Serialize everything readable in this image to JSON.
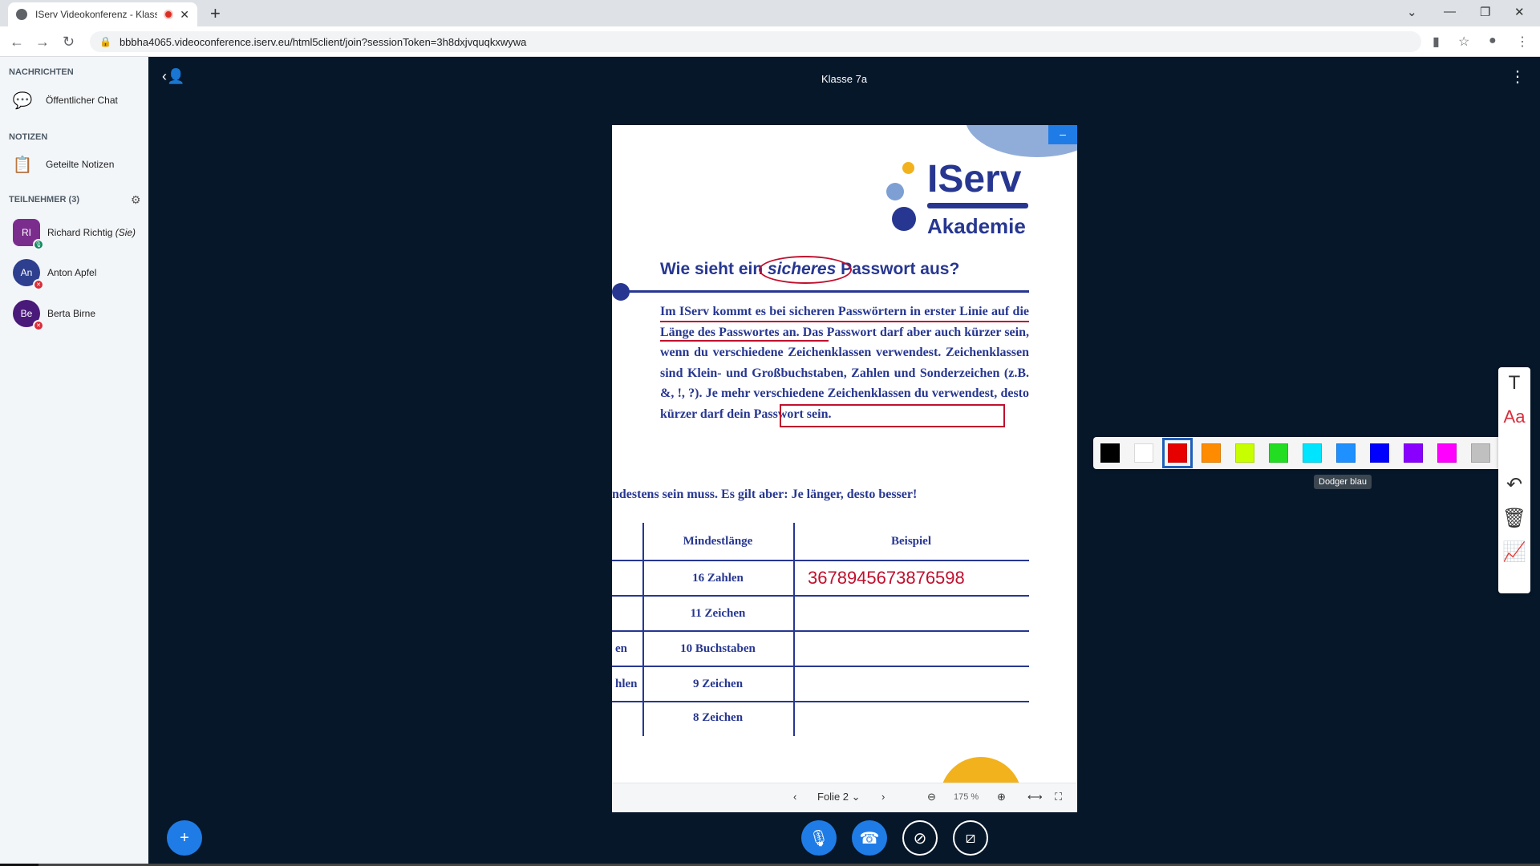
{
  "browser": {
    "tab_title": "IServ Videokonferenz - Klass",
    "url": "bbbha4065.videoconference.iserv.eu/html5client/join?sessionToken=3h8dxjvquqkxwywa"
  },
  "sidebar": {
    "messages_title": "NACHRICHTEN",
    "public_chat": "Öffentlicher Chat",
    "notes_title": "NOTIZEN",
    "shared_notes": "Geteilte Notizen",
    "participants_title": "TEILNEHMER (3)",
    "users": [
      {
        "initials": "RI",
        "name": "Richard Richtig",
        "suffix": "(Sie)",
        "color": "#7b2d8e"
      },
      {
        "initials": "An",
        "name": "Anton Apfel",
        "suffix": "",
        "color": "#2d3f8e"
      },
      {
        "initials": "Be",
        "name": "Berta Birne",
        "suffix": "",
        "color": "#4a1a7a"
      }
    ]
  },
  "main": {
    "room_title": "Klasse 7a"
  },
  "slide": {
    "logo_name": "IServ",
    "logo_sub": "Akademie",
    "heading_before": "Wie sieht ein ",
    "heading_emph": "sicheres",
    "heading_after": " Passwort aus?",
    "paragraph": "Im IServ kommt es bei sicheren Passwörtern in erster Linie auf die Länge des Passwortes an. Das Passwort darf aber auch kürzer sein, wenn du verschiedene Zeichenklassen verwendest. Zeichenklassen sind Klein- und Großbuchstaben, Zahlen und Sonderzeichen (z.B. &, !, ?). Je mehr verschiedene Zeichenklassen du verwendest, desto kürzer darf dein Passwort sein.",
    "partial_line": "ndestens sein muss. Es gilt aber: Je länger, desto besser!",
    "table": {
      "headers": [
        "",
        "Mindestlänge",
        "Beispiel"
      ],
      "rows": [
        {
          "c0": "",
          "c1": "16 Zahlen",
          "c2": "3678945673876598"
        },
        {
          "c0": "",
          "c1": "11 Zeichen",
          "c2": ""
        },
        {
          "c0": "en",
          "c1": "10 Buchstaben",
          "c2": ""
        },
        {
          "c0": "hlen",
          "c1": "9 Zeichen",
          "c2": ""
        },
        {
          "c0": "",
          "c1": "8 Zeichen",
          "c2": ""
        }
      ]
    },
    "controls": {
      "slide_label": "Folie 2",
      "zoom": "175 %"
    }
  },
  "palette": {
    "colors": [
      "#000000",
      "#ffffff",
      "#e60000",
      "#ff8c00",
      "#c8ff00",
      "#22dd22",
      "#00e5ff",
      "#1e90ff",
      "#0000ff",
      "#8a00ff",
      "#ff00ff",
      "#c0c0c0"
    ],
    "selected": "#e60000",
    "current_color": "#e60000",
    "tooltip": "Dodger blau"
  }
}
